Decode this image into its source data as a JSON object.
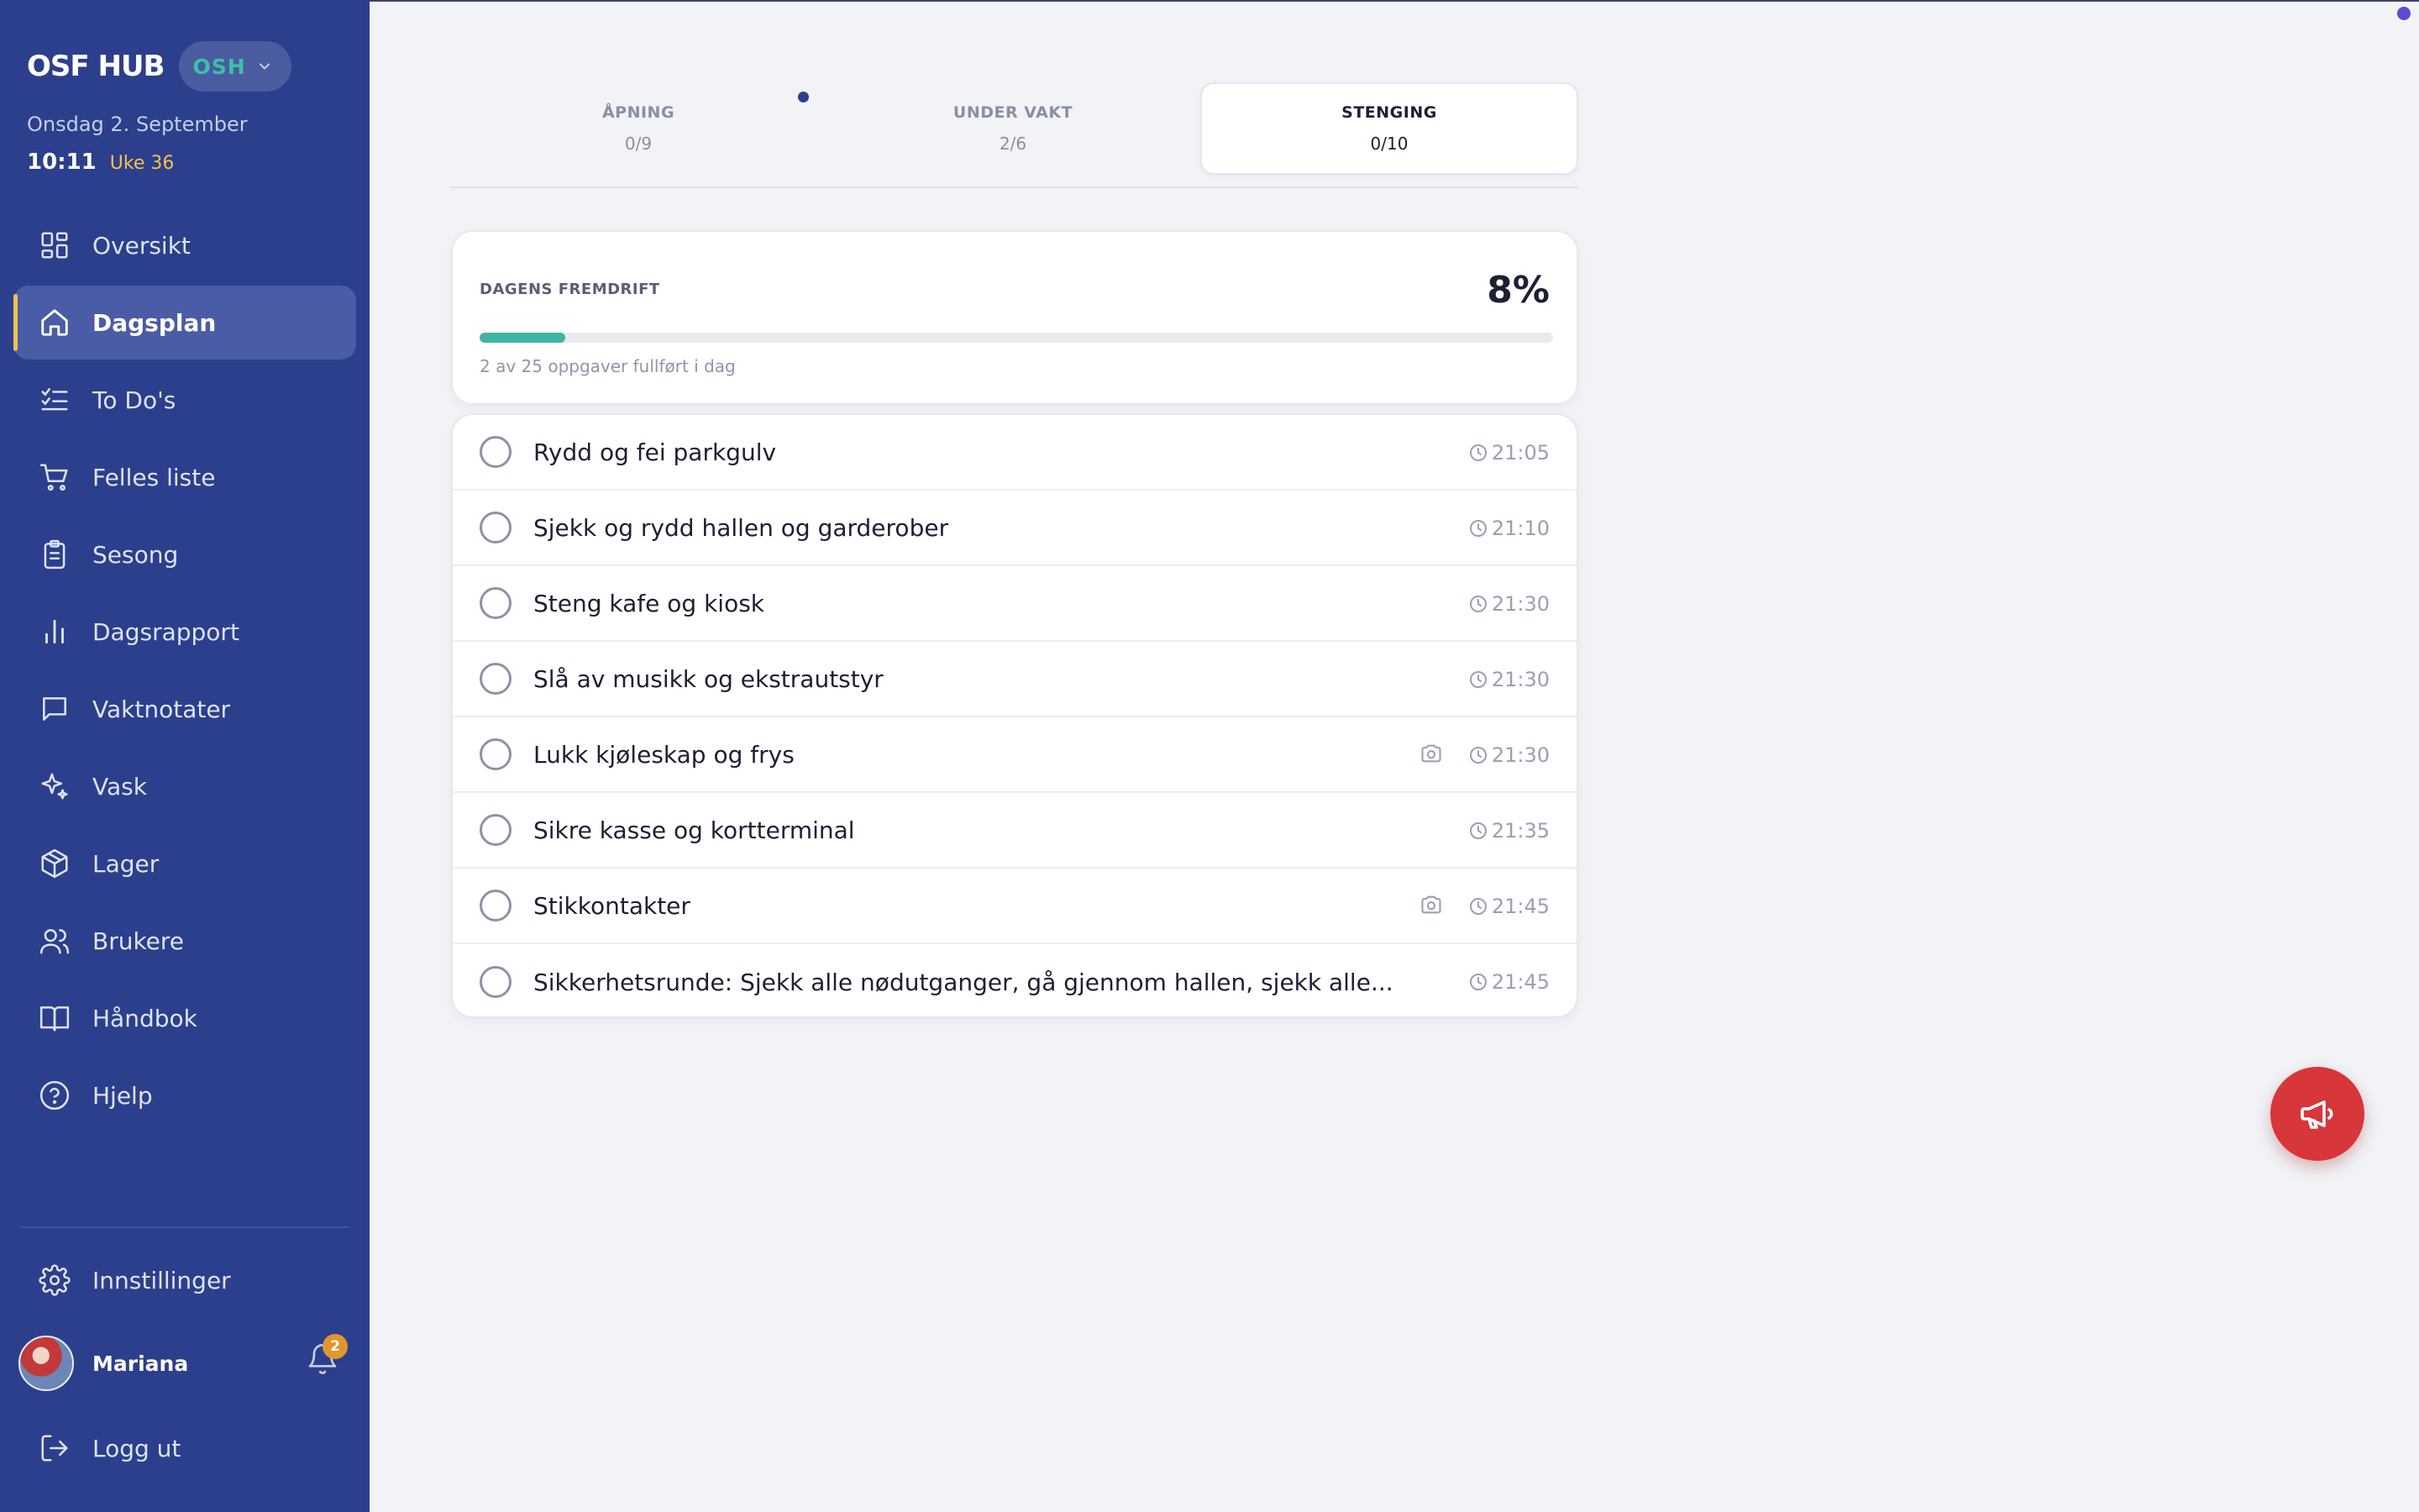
{
  "app": {
    "brand": "OSF HUB",
    "location": "OSH",
    "date": "Onsdag 2. September",
    "time": "10:11",
    "week": "Uke 36"
  },
  "nav": {
    "items": [
      {
        "label": "Oversikt",
        "icon": "grid-icon"
      },
      {
        "label": "Dagsplan",
        "icon": "home-icon",
        "active": true
      },
      {
        "label": "To Do's",
        "icon": "checklist-icon"
      },
      {
        "label": "Felles liste",
        "icon": "cart-icon"
      },
      {
        "label": "Sesong",
        "icon": "clipboard-icon"
      },
      {
        "label": "Dagsrapport",
        "icon": "bar-chart-icon"
      },
      {
        "label": "Vaktnotater",
        "icon": "message-icon"
      },
      {
        "label": "Vask",
        "icon": "sparkle-icon"
      },
      {
        "label": "Lager",
        "icon": "box-icon"
      },
      {
        "label": "Brukere",
        "icon": "users-icon"
      },
      {
        "label": "Håndbok",
        "icon": "book-icon"
      },
      {
        "label": "Hjelp",
        "icon": "help-icon"
      }
    ],
    "settings": "Innstillinger",
    "logout": "Logg ut"
  },
  "user": {
    "name": "Mariana",
    "notifications": "2"
  },
  "tabs": [
    {
      "label": "ÅPNING",
      "count": "0/9"
    },
    {
      "label": "UNDER VAKT",
      "count": "2/6"
    },
    {
      "label": "STENGING",
      "count": "0/10",
      "active": true
    }
  ],
  "progress": {
    "title": "DAGENS FREMDRIFT",
    "percent_label": "8%",
    "fraction": 0.08,
    "subtitle": "2 av 25 oppgaver fullført i dag"
  },
  "tasks": [
    {
      "text": "Rydd og fei parkgulv",
      "time": "21:05",
      "camera": false
    },
    {
      "text": "Sjekk og rydd hallen og garderober",
      "time": "21:10",
      "camera": false
    },
    {
      "text": "Steng kafe og kiosk",
      "time": "21:30",
      "camera": false
    },
    {
      "text": "Slå av musikk og ekstrautstyr",
      "time": "21:30",
      "camera": false
    },
    {
      "text": "Lukk kjøleskap og frys",
      "time": "21:30",
      "camera": true
    },
    {
      "text": "Sikre kasse og kortterminal",
      "time": "21:35",
      "camera": false
    },
    {
      "text": "Stikkontakter",
      "time": "21:45",
      "camera": true
    },
    {
      "text": "Sikkerhetsrunde: Sjekk alle nødutganger, gå gjennom hallen, sjekk alle...",
      "time": "21:45",
      "camera": false
    }
  ],
  "colors": {
    "sidebar": "#2c3f8c",
    "accent_yellow": "#f2c14e",
    "accent_teal": "#3fb4a6",
    "fab_red": "#d7363a"
  }
}
